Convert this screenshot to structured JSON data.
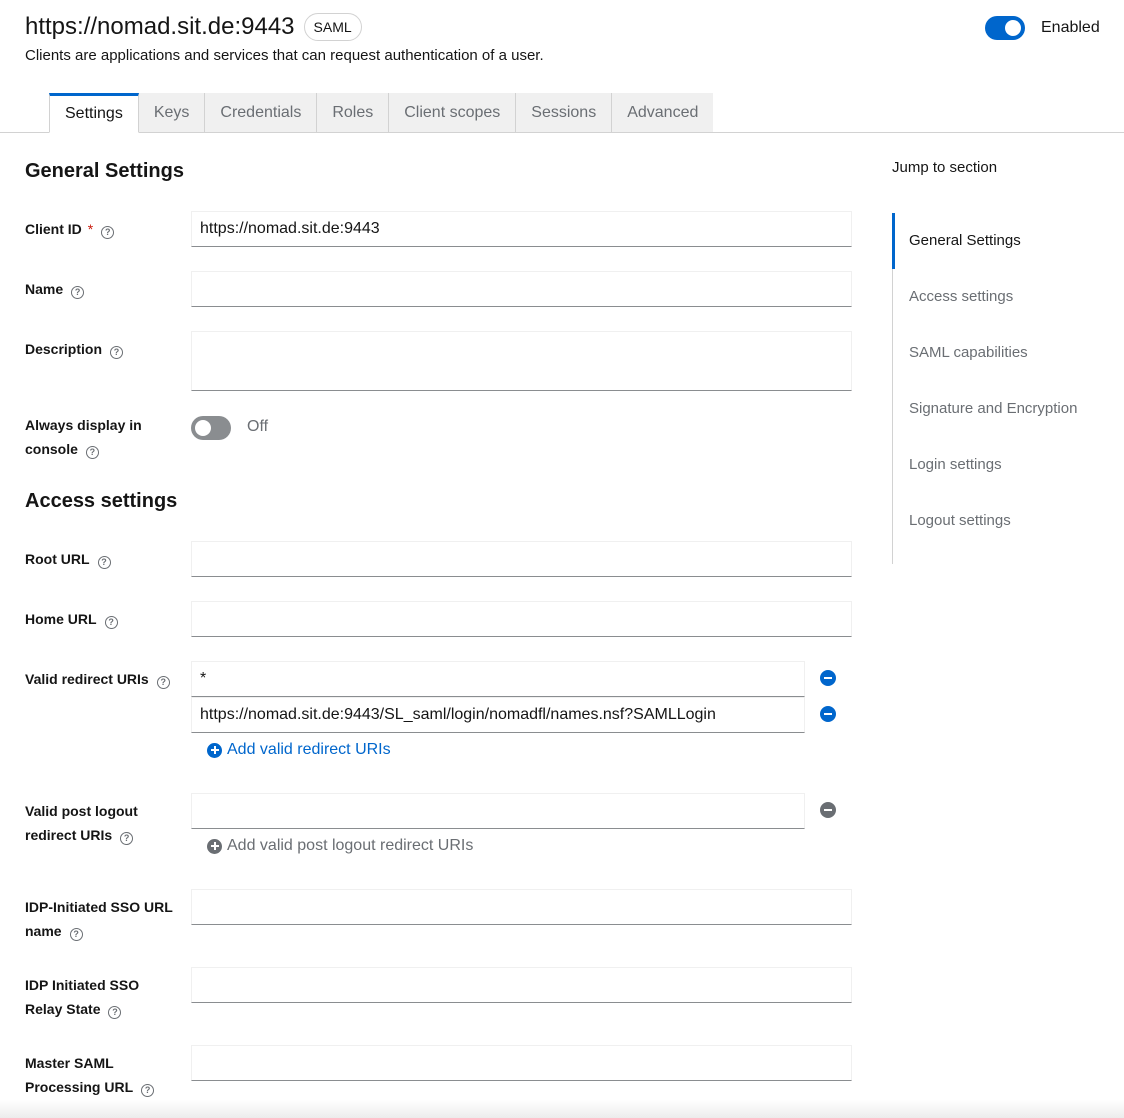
{
  "header": {
    "title": "https://nomad.sit.de:9443",
    "protocol_badge": "SAML",
    "subtitle": "Clients are applications and services that can request authentication of a user.",
    "enabled_label": "Enabled"
  },
  "tabs": [
    {
      "label": "Settings",
      "active": true
    },
    {
      "label": "Keys"
    },
    {
      "label": "Credentials"
    },
    {
      "label": "Roles"
    },
    {
      "label": "Client scopes"
    },
    {
      "label": "Sessions"
    },
    {
      "label": "Advanced"
    }
  ],
  "general": {
    "title": "General Settings",
    "client_id_label": "Client ID",
    "required_mark": "*",
    "client_id_value": "https://nomad.sit.de:9443",
    "name_label": "Name",
    "name_value": "",
    "description_label": "Description",
    "description_value": "",
    "always_display_label_1": "Always display in",
    "always_display_label_2": "console",
    "always_display_state": "Off"
  },
  "access": {
    "title": "Access settings",
    "root_url_label": "Root URL",
    "root_url_value": "",
    "home_url_label": "Home URL",
    "home_url_value": "",
    "redirect_label": "Valid redirect URIs",
    "redirect_uris": [
      "*",
      "https://nomad.sit.de:9443/SL_saml/login/nomadfl/names.nsf?SAMLLogin"
    ],
    "add_redirect": "Add valid redirect URIs",
    "post_logout_label_1": "Valid post logout",
    "post_logout_label_2": "redirect URIs",
    "post_logout_value": "",
    "add_post_logout": "Add valid post logout redirect URIs",
    "idp_sso_label_1": "IDP-Initiated SSO URL",
    "idp_sso_label_2": "name",
    "idp_sso_value": "",
    "relay_label_1": "IDP Initiated SSO",
    "relay_label_2": "Relay State",
    "relay_value": "",
    "master_label_1": "Master SAML",
    "master_label_2": "Processing URL",
    "master_value": ""
  },
  "jump": {
    "title": "Jump to section",
    "items": [
      "General Settings",
      "Access settings",
      "SAML capabilities",
      "Signature and Encryption",
      "Login settings",
      "Logout settings"
    ]
  },
  "colors": {
    "accent": "#0066cc",
    "required": "#c9190b",
    "muted": "#6a6e73"
  },
  "icons": {
    "help": "question-circle-icon",
    "remove": "minus-circle-icon",
    "add": "plus-circle-icon"
  }
}
